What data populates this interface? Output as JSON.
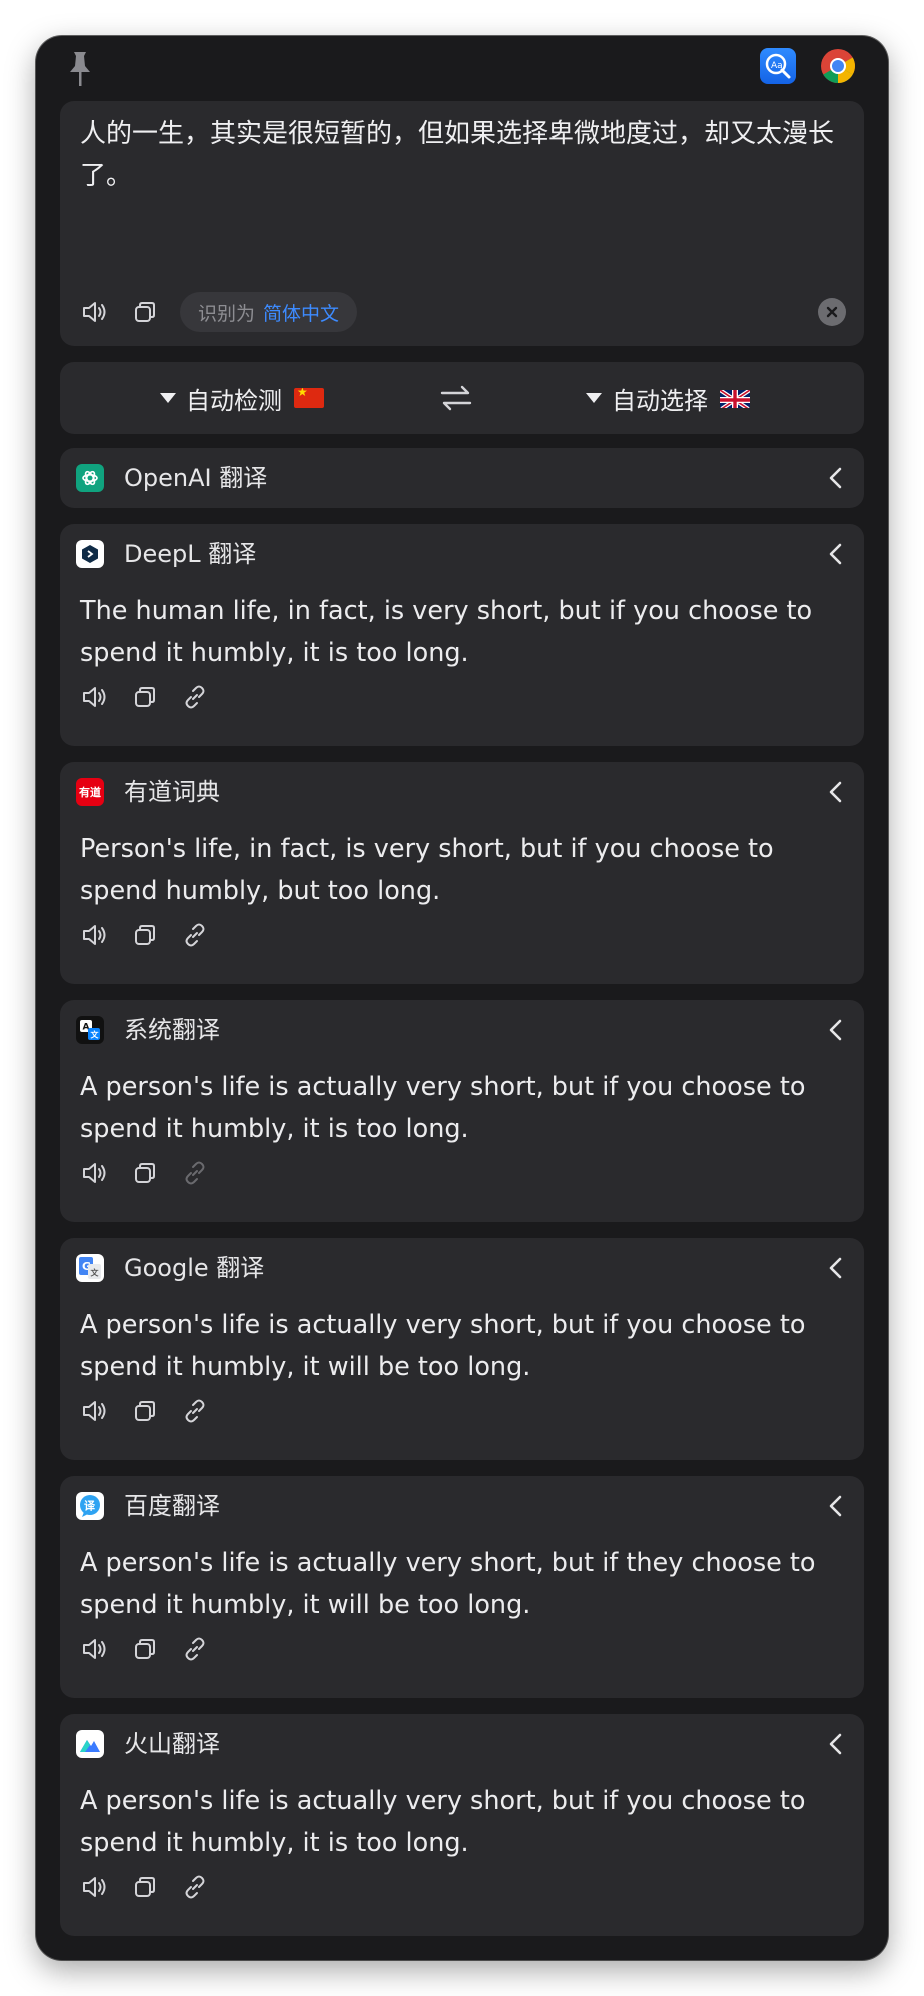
{
  "input": {
    "text": "人的一生，其实是很短暂的，但如果选择卑微地度过，却又太漫长了。",
    "detect_prefix": "识别为",
    "detect_lang": "简体中文"
  },
  "languages": {
    "source": "自动检测",
    "source_flag": "china-flag",
    "target": "自动选择",
    "target_flag": "uk-flag",
    "swap_icon": "swap-arrows-icon"
  },
  "services": [
    {
      "name": "OpenAI 翻译",
      "logo": "openai-logo-icon",
      "logo_color": "#10a37f",
      "collapsed": true,
      "result": ""
    },
    {
      "name": "DeepL 翻译",
      "logo": "deepl-logo-icon",
      "logo_color": "#ffffff",
      "collapsed": false,
      "result": "The human life, in fact, is very short, but if you choose to spend it humbly, it is too long."
    },
    {
      "name": "有道词典",
      "logo": "youdao-logo-icon",
      "logo_text": "有道",
      "logo_color": "#e60012",
      "collapsed": false,
      "result": "Person's life, in fact, is very short, but if you choose to spend humbly, but too long."
    },
    {
      "name": "系统翻译",
      "logo": "apple-translate-logo-icon",
      "logo_color": "#0a84ff",
      "collapsed": false,
      "result": "A person's life is actually very short, but if you choose to spend it humbly, it is too long.",
      "link_disabled": true
    },
    {
      "name": "Google 翻译",
      "logo": "google-translate-logo-icon",
      "logo_color": "#4285f4",
      "collapsed": false,
      "result": "A person's life is actually very short, but if you choose to spend it humbly, it will be too long."
    },
    {
      "name": "百度翻译",
      "logo": "baidu-translate-logo-icon",
      "logo_text": "译",
      "logo_color": "#2ea3f2",
      "collapsed": false,
      "result": "A person's life is actually very short, but if they choose to spend it humbly, it will be too long."
    },
    {
      "name": "火山翻译",
      "logo": "volcano-translate-logo-icon",
      "logo_color": "#3a7bff",
      "collapsed": false,
      "result": "A person's life is actually very short, but if you choose to spend it humbly, it is too long."
    }
  ],
  "colors": {
    "window_bg": "#1a1a1c",
    "card_bg": "#2a2a2d",
    "accent": "#3d8bff"
  }
}
